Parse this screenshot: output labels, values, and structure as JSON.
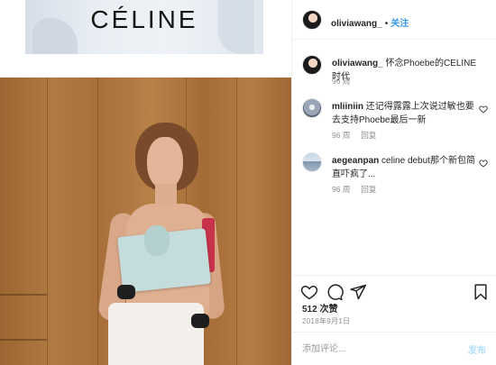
{
  "ad": {
    "brand": "CÉLINE"
  },
  "header": {
    "username": "oliviawang_",
    "separator": "•",
    "follow_label": "关注"
  },
  "caption": {
    "username": "oliviawang_",
    "text": "怀念Phoebe的CELINE时代",
    "time": "96 周"
  },
  "comments": [
    {
      "username": "mliiniin",
      "text": "还记得露露上次说过敏也要去支持Phoebe最后一新",
      "time": "96 周",
      "reply": "回复"
    },
    {
      "username": "aegeanpan",
      "text": "celine debut那个新包简直吓疯了...",
      "time": "96 周",
      "reply": "回复"
    }
  ],
  "actions": {
    "likes": "512 次赞",
    "date": "2018年9月1日"
  },
  "add_comment": {
    "placeholder": "添加评论...",
    "post_label": "发布"
  },
  "icons": {
    "like": "heart-icon",
    "comment": "comment-icon",
    "share": "share-icon",
    "save": "bookmark-icon",
    "comment_like": "small-heart-icon"
  },
  "colors": {
    "link_blue": "#3897f0",
    "post_disabled": "#b2dffc",
    "muted_text": "#8e8e8e"
  }
}
